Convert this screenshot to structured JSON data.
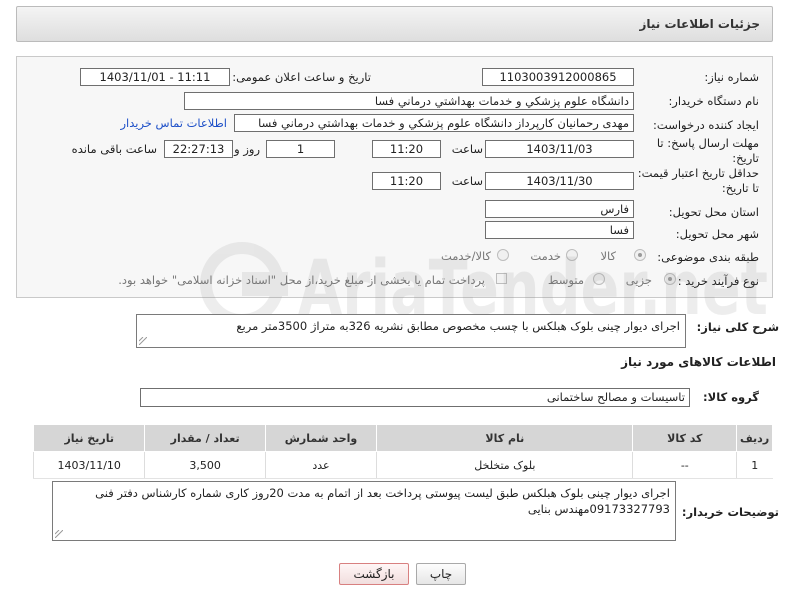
{
  "page": {
    "title": "جزئیات اطلاعات نیاز"
  },
  "form": {
    "need_number_label": "شماره نیاز:",
    "need_number": "1103003912000865",
    "announce_label": "تاریخ و ساعت اعلان عمومی:",
    "announce_value": "1403/11/01 - 11:11",
    "buyer_org_label": "نام دستگاه خریدار:",
    "buyer_org": "دانشگاه علوم پزشکي و خدمات بهداشتي درماني فسا",
    "requester_label": "ایجاد کننده درخواست:",
    "requester": "مهدی رحمانیان کارپرداز دانشگاه علوم پزشکي و خدمات بهداشتي درماني فسا",
    "contact_link": "اطلاعات تماس خریدار",
    "deadline_label": "مهلت ارسال پاسخ: تا تاریخ:",
    "deadline_date": "1403/11/03",
    "time_label": "ساعت",
    "deadline_time": "11:20",
    "days_value": "1",
    "days_label": "روز و",
    "remaining_time": "22:27:13",
    "remaining_label": "ساعت باقی مانده",
    "validity_label": "حداقل تاریخ اعتبار قیمت: تا تاریخ:",
    "validity_date": "1403/11/30",
    "validity_time": "11:20",
    "province_label": "استان محل تحویل:",
    "province": "فارس",
    "city_label": "شهر محل تحویل:",
    "city": "فسا",
    "category_label": "طبقه بندی موضوعی:",
    "category_options": [
      "کالا",
      "خدمت",
      "کالا/خدمت"
    ],
    "process_label": "نوع فرآیند خرید :",
    "process_options": [
      "جزیی",
      "متوسط"
    ],
    "payment_note": "پرداخت تمام یا بخشی از مبلغ خرید،از محل \"اسناد خزانه اسلامی\" خواهد بود."
  },
  "summary": {
    "label": "شرح کلی نیاز:",
    "text": "اجرای دیوار چینی بلوک هبلکس با چسب مخصوص مطابق نشریه 326به متراژ 3500متر مربع"
  },
  "goods": {
    "section_title": "اطلاعات کالاهای مورد نیاز",
    "group_label": "گروه کالا:",
    "group_value": "تاسیسات و مصالح ساختمانی",
    "columns": [
      "ردیف",
      "کد کالا",
      "نام کالا",
      "واحد شمارش",
      "تعداد / مقدار",
      "تاریخ نیاز"
    ],
    "rows": [
      [
        "1",
        "--",
        "بلوک متخلخل",
        "عدد",
        "3,500",
        "1403/11/10"
      ]
    ]
  },
  "buyer_notes": {
    "label": "توضیحات خریدار:",
    "text": "اجرای دیوار چینی بلوک هبلکس طبق لیست پیوستی پرداخت بعد از اتمام به مدت 20روز کاری شماره کارشناس دفتر فنی 09173327793مهندس بنایی"
  },
  "buttons": {
    "print": "چاپ",
    "back": "بازگشت"
  },
  "colors": {
    "link": "#1e50c8",
    "back_button_border": "#d88080"
  },
  "watermark": {
    "text": "AriaTender.net"
  }
}
